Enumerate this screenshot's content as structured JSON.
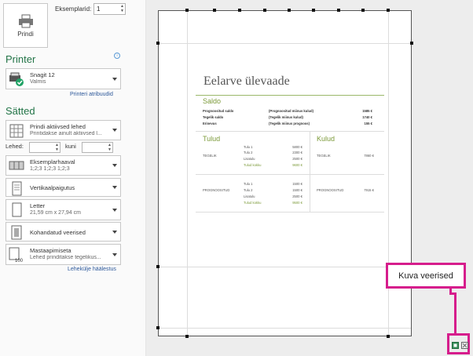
{
  "print": {
    "button_label": "Prindi",
    "copies_label": "Eksemplarid:",
    "copies_value": "1"
  },
  "printer": {
    "section_title": "Printer",
    "name": "Snagit 12",
    "status": "Valmis",
    "properties_link": "Printeri atribuudid"
  },
  "settings": {
    "section_title": "Sätted",
    "print_what": {
      "title": "Prindi aktiivsed lehed",
      "sub": "Printidakse ainult aktiivsed l..."
    },
    "pages_label": "Lehed:",
    "to_label": "kuni",
    "collate": {
      "title": "Eksemplarhaaval",
      "sub": "1;2;3    1;2;3    1;2;3"
    },
    "orientation": {
      "title": "Vertikaalpaigutus"
    },
    "paper": {
      "title": "Letter",
      "sub": "21,59 cm x 27,94 cm"
    },
    "margins": {
      "title": "Kohandatud veerised"
    },
    "scaling": {
      "title": "Mastaapimiseta",
      "sub": "Lehed prinditakse tegelikus..."
    },
    "page_setup_link": "Lehekülje häälestus"
  },
  "document": {
    "title": "Eelarve ülevaade",
    "balance": {
      "heading": "Saldo",
      "rows": [
        {
          "label": "Prognoositud saldo",
          "desc": "(Prognoositud miinus kulud)",
          "value": "1585 €"
        },
        {
          "label": "Tegelik saldo",
          "desc": "(Tegelik miinus kulud)",
          "value": "1740 €"
        },
        {
          "label": "Erinevus",
          "desc": "(Tegelik miinus prognoos)",
          "value": "155 €"
        }
      ]
    },
    "income": {
      "heading": "Tulud",
      "actual_label": "TEGELIK",
      "actual_rows": [
        {
          "label": "Tulu 1",
          "value": "5800 €"
        },
        {
          "label": "Tulu 2",
          "value": "2300 €"
        },
        {
          "label": "Lisatulu",
          "value": "2500 €"
        }
      ],
      "actual_total": {
        "label": "Tulud kokku",
        "value": "9600 €"
      },
      "projected_label": "PROGNOOSITUD",
      "projected_rows": [
        {
          "label": "Tulu 1",
          "value": "1500 €"
        },
        {
          "label": "Tulu 2",
          "value": "1500 €"
        },
        {
          "label": "Lisatulu",
          "value": "2500 €"
        }
      ],
      "projected_total": {
        "label": "Tulud kokku",
        "value": "9500 €"
      }
    },
    "expenses": {
      "heading": "Kulud",
      "actual_label": "TEGELIK",
      "actual_value": "7860 €",
      "projected_label": "PROGNOOSITUD",
      "projected_value": "7915 €"
    }
  },
  "callout": {
    "text": "Kuva veerised"
  },
  "colors": {
    "accent_green": "#217346",
    "highlight_pink": "#d61d8c",
    "link_blue": "#2b579a"
  }
}
